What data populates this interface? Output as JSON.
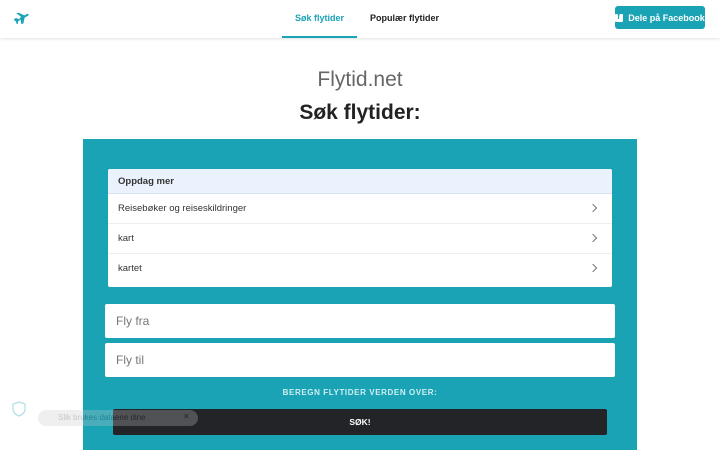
{
  "nav": {
    "tabs": [
      {
        "label": "Søk flytider",
        "active": true
      },
      {
        "label": "Populær flytider",
        "active": false
      }
    ],
    "share_button": "Dele på Facebook"
  },
  "header": {
    "site_title": "Flytid.net",
    "page_title": "Søk flytider:"
  },
  "discover": {
    "heading": "Oppdag mer",
    "items": [
      "Reisebøker og reiseskildringer",
      "kart",
      "kartet"
    ]
  },
  "form": {
    "from_placeholder": "Fly fra",
    "to_placeholder": "Fly til",
    "calc_label": "BEREGN FLYTIDER VERDEN OVER:",
    "search_button": "SØK!"
  },
  "consent": {
    "title": "Slik brukes dataene dine",
    "close": "✕"
  },
  "colors": {
    "accent": "#1aa3b5",
    "dark_button": "#222428",
    "discover_header": "#eaf2fd"
  }
}
